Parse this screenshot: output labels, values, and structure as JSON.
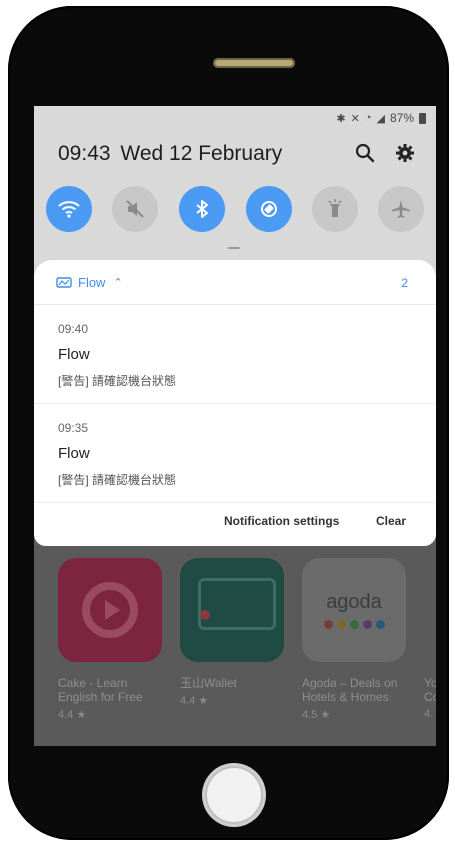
{
  "status_bar": {
    "battery": "87%",
    "icons": [
      "bluetooth-icon",
      "mute-icon",
      "wifi-icon",
      "signal-icon"
    ]
  },
  "header": {
    "time": "09:43",
    "date": "Wed 12 February",
    "icons": [
      "search-icon",
      "gear-icon"
    ]
  },
  "quick_settings": [
    {
      "name": "wifi-icon",
      "on": true
    },
    {
      "name": "mute-icon",
      "on": false
    },
    {
      "name": "bluetooth-icon",
      "on": true
    },
    {
      "name": "auto-rotate-icon",
      "on": true
    },
    {
      "name": "flashlight-icon",
      "on": false
    },
    {
      "name": "airplane-icon",
      "on": false
    }
  ],
  "notification_group": {
    "app_name": "Flow",
    "count": "2",
    "items": [
      {
        "time": "09:40",
        "title": "Flow",
        "body": "[警告] 請確認機台狀態"
      },
      {
        "time": "09:35",
        "title": "Flow",
        "body": "[警告] 請確認機台狀態"
      }
    ],
    "actions": {
      "settings": "Notification settings",
      "clear": "Clear"
    }
  },
  "background_apps": [
    {
      "name": "Cake - Learn English for Free",
      "name_line1": "Cake - Learn",
      "name_line2": "English for Free",
      "rating": "4.4 ★",
      "color": "#7d2440"
    },
    {
      "name": "玉山Wallet",
      "name_line1": "玉山Wallet",
      "name_line2": "",
      "rating": "4.4 ★",
      "color": "#1f4b44"
    },
    {
      "name": "Agoda – Deals on Hotels & Homes",
      "name_line1": "Agoda – Deals on",
      "name_line2": "Hotels & Homes",
      "rating": "4.5 ★",
      "color": "#6b6b6b",
      "logo_text": "agoda"
    },
    {
      "name": "Yo Co",
      "name_line1": "Yo",
      "name_line2": "Co",
      "rating": "4.",
      "color": "#5a5a5a"
    }
  ]
}
